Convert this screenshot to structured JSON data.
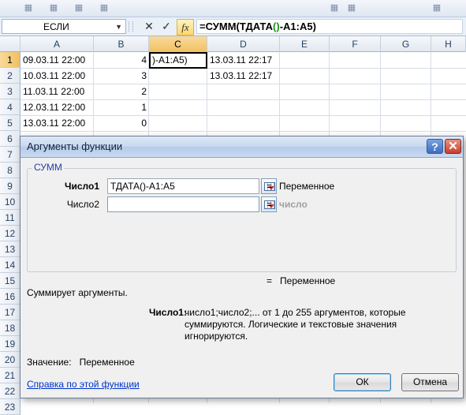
{
  "formula_bar": {
    "name_box": "ЕСЛИ",
    "name_box_arrow": "▼",
    "cancel_glyph": "✕",
    "enter_glyph": "✓",
    "fx_glyph": "fx",
    "formula_prefix": "=СУММ(ТДАТА",
    "formula_paren": "()",
    "formula_suffix": "-A1:A5)"
  },
  "grid": {
    "columns": [
      "A",
      "B",
      "C",
      "D",
      "E",
      "F",
      "G",
      "H"
    ],
    "active_column": "C",
    "rows": [
      "1",
      "2",
      "3",
      "4",
      "5",
      "6",
      "7",
      "8",
      "9",
      "10",
      "11",
      "12",
      "13",
      "14",
      "15",
      "16",
      "17",
      "18",
      "19",
      "20",
      "21",
      "22",
      "23"
    ],
    "active_row": "1",
    "cells": {
      "A1": "09.03.11 22:00",
      "B1": "4",
      "C1": ")-A1:A5)",
      "D1": "13.03.11 22:17",
      "A2": "10.03.11 22:00",
      "B2": "3",
      "D2": "13.03.11 22:17",
      "A3": "11.03.11 22:00",
      "B3": "2",
      "A4": "12.03.11 22:00",
      "B4": "1",
      "A5": "13.03.11 22:00",
      "B5": "0"
    }
  },
  "dialog": {
    "title": "Аргументы функции",
    "help_glyph": "?",
    "close_glyph": "✕",
    "function_name": "СУММ",
    "args": [
      {
        "label": "Число1",
        "value": "ТДАТА()-A1:A5",
        "eq": "=",
        "result": "Переменное"
      },
      {
        "label": "Число2",
        "value": "",
        "eq": "=",
        "result": "число"
      }
    ],
    "result_eq": "=",
    "result": "Переменное",
    "description": "Суммирует аргументы.",
    "arg_desc_name": "Число1:",
    "arg_desc_text": "число1;число2;... от 1 до 255 аргументов, которые суммируются. Логические и текстовые значения игнорируются.",
    "value_label": "Значение:",
    "value": "Переменное",
    "help_link": "Справка по этой функции",
    "ok_label": "ОК",
    "cancel_label": "Отмена"
  }
}
